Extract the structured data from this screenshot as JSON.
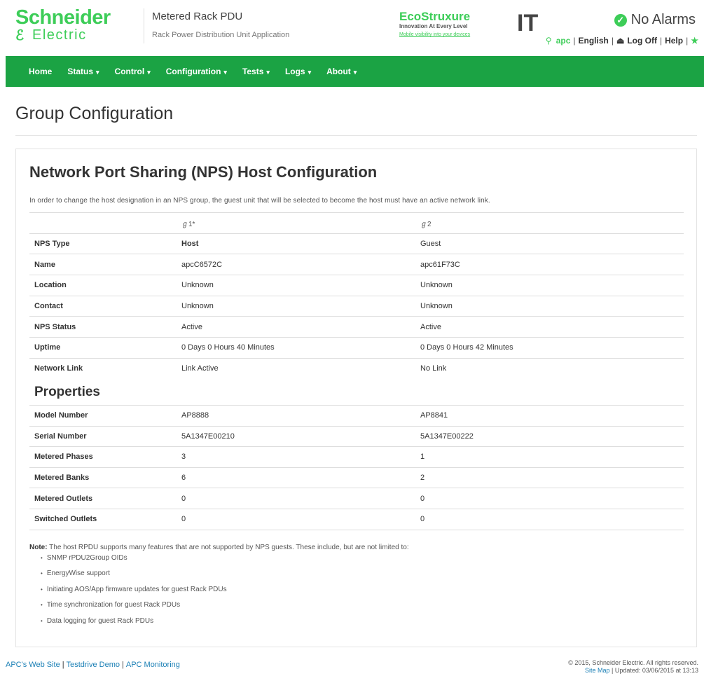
{
  "brand": {
    "logo_top": "Schneider",
    "logo_bottom": "Electric",
    "app_title": "Metered Rack PDU",
    "app_subtitle": "Rack Power Distribution Unit Application",
    "eco_main": "EcoStruxure",
    "eco_sub1": "Innovation At Every Level",
    "eco_sub2": "Mobile visibility into your devices",
    "eco_it": "IT"
  },
  "alarms": {
    "label": "No Alarms",
    "icon": "check-icon",
    "color": "#3dcd58"
  },
  "toplinks": {
    "user": "apc",
    "language": "English",
    "logoff": "Log Off",
    "help": "Help"
  },
  "nav": {
    "items": [
      {
        "label": "Home",
        "dropdown": false
      },
      {
        "label": "Status",
        "dropdown": true
      },
      {
        "label": "Control",
        "dropdown": true
      },
      {
        "label": "Configuration",
        "dropdown": true
      },
      {
        "label": "Tests",
        "dropdown": true
      },
      {
        "label": "Logs",
        "dropdown": true
      },
      {
        "label": "About",
        "dropdown": true
      }
    ],
    "background": "#1ba344"
  },
  "page_title": "Group Configuration",
  "nps": {
    "title": "Network Port Sharing (NPS) Host Configuration",
    "intro": "In order to change the host designation in an NPS group, the guest unit that will be selected to become the host must have an active network link.",
    "columns": [
      "",
      "ℊ1*",
      "ℊ2"
    ],
    "rows": [
      {
        "label": "NPS Type",
        "v1": "Host",
        "v2": "Guest"
      },
      {
        "label": "Name",
        "v1": "apcC6572C",
        "v2": "apc61F73C"
      },
      {
        "label": "Location",
        "v1": "Unknown",
        "v2": "Unknown"
      },
      {
        "label": "Contact",
        "v1": "Unknown",
        "v2": "Unknown"
      },
      {
        "label": "NPS Status",
        "v1": "Active",
        "v2": "Active"
      },
      {
        "label": "Uptime",
        "v1": "0 Days 0 Hours 40 Minutes",
        "v2": "0 Days 0 Hours 42 Minutes"
      },
      {
        "label": "Network Link",
        "v1": "Link Active",
        "v2": "No Link"
      }
    ]
  },
  "properties": {
    "title": "Properties",
    "rows": [
      {
        "label": "Model Number",
        "v1": "AP8888",
        "v2": "AP8841"
      },
      {
        "label": "Serial Number",
        "v1": "5A1347E00210",
        "v2": "5A1347E00222"
      },
      {
        "label": "Metered Phases",
        "v1": "3",
        "v2": "1"
      },
      {
        "label": "Metered Banks",
        "v1": "6",
        "v2": "2"
      },
      {
        "label": "Metered Outlets",
        "v1": "0",
        "v2": "0"
      },
      {
        "label": "Switched Outlets",
        "v1": "0",
        "v2": "0"
      }
    ]
  },
  "note": {
    "label": "Note:",
    "text": "The host RPDU supports many features that are not supported by NPS guests. These include, but are not limited to:",
    "items": [
      "SNMP rPDU2Group OIDs",
      "EnergyWise support",
      "Initiating AOS/App firmware updates for guest Rack PDUs",
      "Time synchronization for guest Rack PDUs",
      "Data logging for guest Rack PDUs"
    ]
  },
  "footer": {
    "links": [
      "APC's Web Site",
      "Testdrive Demo",
      "APC Monitoring"
    ],
    "copyright": "© 2015, Schneider Electric. All rights reserved.",
    "sitemap": "Site Map",
    "updated": "Updated: 03/06/2015 at 13:13"
  }
}
